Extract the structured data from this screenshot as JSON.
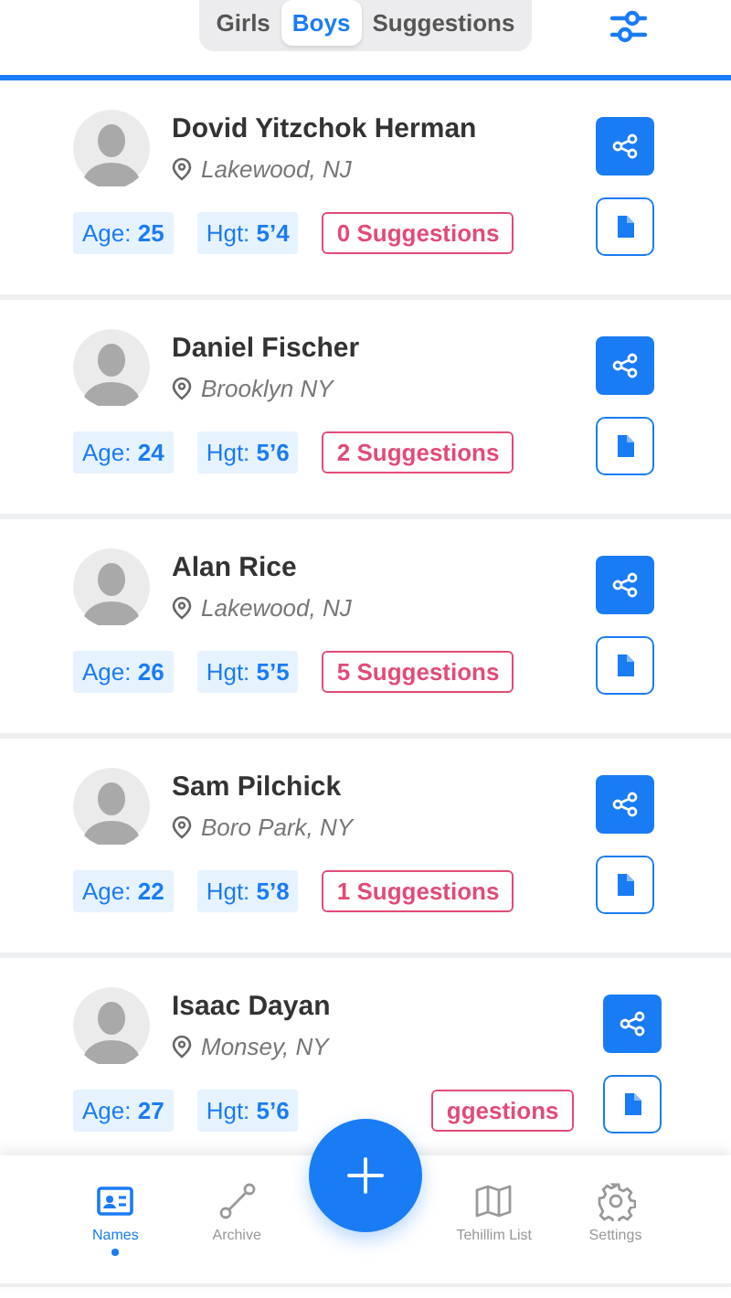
{
  "tabs": [
    {
      "label": "Girls",
      "selected": false
    },
    {
      "label": "Boys",
      "selected": true
    },
    {
      "label": "Suggestions",
      "selected": false
    }
  ],
  "people": [
    {
      "name": "Dovid Yitzchok Herman",
      "location": "Lakewood, NJ",
      "age": "Age: **25**",
      "height": "Hgt: **5’4**",
      "suggestions": "0 Suggestions"
    },
    {
      "name": "Daniel Fischer",
      "location": "Brooklyn NY",
      "age": "Age: **24**",
      "height": "Hgt: **5’6**",
      "suggestions": "2 Suggestions"
    },
    {
      "name": "Alan Rice",
      "location": "Lakewood, NJ",
      "age": "Age: **26**",
      "height": "Hgt: **5’5**",
      "suggestions": "5 Suggestions"
    },
    {
      "name": "Sam Pilchick",
      "location": "Boro Park, NY",
      "age": "Age: **22**",
      "height": "Hgt: **5’8**",
      "suggestions": "1 Suggestions"
    },
    {
      "name": "Isaac Dayan",
      "location": "Monsey, NY",
      "age": "Age: **27**",
      "height": "Hgt: **5’6**",
      "suggestions": "ggestions"
    }
  ],
  "nav": [
    {
      "kind": "names",
      "label": "Names",
      "selected": true
    },
    {
      "kind": "archive",
      "label": "Archive",
      "selected": false
    },
    {
      "kind": "fab"
    },
    {
      "kind": "book",
      "label": "Tehillim List",
      "selected": false
    },
    {
      "kind": "settings",
      "label": "Settings",
      "selected": false
    }
  ]
}
